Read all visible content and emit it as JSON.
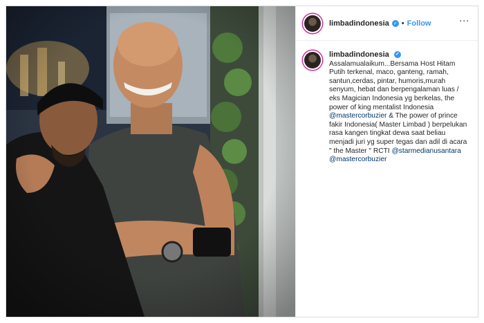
{
  "post": {
    "username": "limbadindonesia",
    "separator": "•",
    "follow_label": "Follow",
    "more_label": "...",
    "verified_mark": "✓"
  },
  "caption": {
    "username": "limbadindonesia",
    "text_1": "Assalamualaikum...Bersama Host Hitam Putih terkenal, maco, ganteng, ramah, santun,cerdas, pintar, humoris,murah senyum, hebat dan berpengalaman luas / eks Magician Indonesia yg berkelas, the power of king mentalist Indonesia",
    "mention_1": "@mastercorbuzier",
    "text_2": " & The power of prince fakir Indonesia( Master Limbad ) berpelukan rasa kangen tingkat dewa saat beliau menjadi juri yg super tegas dan adil di acara \" the Master \" RCTI ",
    "mention_2": "@starmedianusantara",
    "mention_3": "@mastercorbuzier"
  },
  "icons": {
    "verified": "verified-badge-icon",
    "more": "more-options-icon"
  },
  "colors": {
    "link_blue": "#3897f0",
    "mention_blue": "#003569",
    "text": "#262626",
    "border": "#dbdbdb"
  }
}
